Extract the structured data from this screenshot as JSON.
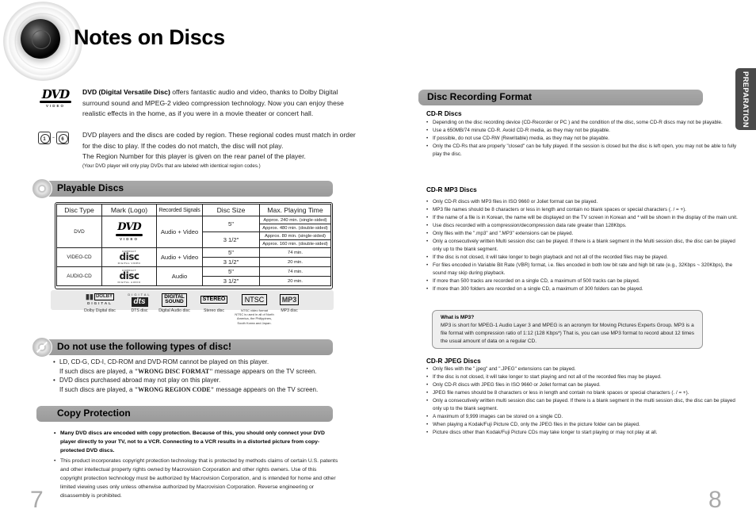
{
  "left_page": {
    "title": "Notes on Discs",
    "page_number": "7",
    "dvd_intro": {
      "logo_text": "DVD",
      "logo_sub": "VIDEO",
      "bold_lead": "DVD (Digital Versatile Disc)",
      "text": " offers fantastic audio and video, thanks to Dolby Digital surround sound and MPEG-2 video compression technology. Now you can enjoy these realistic effects in the home, as if you were in a movie theater or concert hall."
    },
    "region_intro": {
      "icon_from": "1",
      "icon_to": "6",
      "line1": "DVD players and the discs are coded by region. These regional codes must match in order for the disc to play. If the codes do not match, the disc will not play.",
      "line2": "The Region Number for this player is given on the rear panel of the player.",
      "note": "(Your DVD player will only play DVDs that are labeled with identical region codes.)"
    },
    "playable": {
      "heading": "Playable Discs",
      "headers": [
        "Disc Type",
        "Mark (Logo)",
        "Recorded Signals",
        "Disc Size",
        "Max. Playing Time"
      ],
      "rows": [
        {
          "type": "DVD",
          "logo": "DVD",
          "logo_sub": "VIDEO",
          "signals": "Audio + Video",
          "sizes": [
            {
              "size": "5\"",
              "times": [
                "Approx. 240 min. (single-sided)",
                "Approx. 480 min. (double-sided)"
              ]
            },
            {
              "size": "3 1/2\"",
              "times": [
                "Approx. 80 min. (single-sided)",
                "Approx. 160 min. (double-sided)"
              ]
            }
          ]
        },
        {
          "type": "VIDEO-CD",
          "logo": "disc",
          "logo_top": "COMPACT",
          "logo_sub": "DIGITAL VIDEO",
          "signals": "Audio + Video",
          "sizes": [
            {
              "size": "5\"",
              "times": [
                "74 min."
              ]
            },
            {
              "size": "3 1/2\"",
              "times": [
                "20 min."
              ]
            }
          ]
        },
        {
          "type": "AUDIO-CD",
          "logo": "disc",
          "logo_top": "COMPACT",
          "logo_sub": "DIGITAL AUDIO",
          "signals": "Audio",
          "sizes": [
            {
              "size": "5\"",
              "times": [
                "74 min."
              ]
            },
            {
              "size": "3 1/2\"",
              "times": [
                "20 min."
              ]
            }
          ]
        }
      ],
      "logos": [
        {
          "mark": "DOLBY",
          "mark_sub": "DIGITAL",
          "caption": "Dolby Digital disc"
        },
        {
          "mark": "dts",
          "mark_sub": "SURROUND",
          "mark_top": "DIGITAL",
          "caption": "DTS disc"
        },
        {
          "mark": "DIGITAL SOUND",
          "caption": "Digital Audio disc"
        },
        {
          "mark": "STEREO",
          "caption": "Stereo disc"
        },
        {
          "mark": "NTSC",
          "caption": "NTSC video format",
          "caption_extra": "NTSC is used in all of North America, the Philippines, South Korea and Japan."
        },
        {
          "mark": "MP3",
          "caption": "MP3 disc"
        }
      ]
    },
    "do_not_use": {
      "heading": "Do not use the following types of disc!",
      "items": [
        {
          "line1": "LD, CD-G, CD-I, CD-ROM and DVD-ROM cannot be played on this player.",
          "line2_pre": "If such discs are played, a ",
          "line2_msg": "\"WRONG DISC FORMAT\"",
          "line2_post": " message appears on the TV screen."
        },
        {
          "line1": "DVD discs purchased abroad may not play on this player.",
          "line2_pre": "If such discs are played, a ",
          "line2_msg": "\"WRONG REGION CODE\"",
          "line2_post": " message appears on the TV screen."
        }
      ]
    },
    "copy_protection": {
      "heading": "Copy Protection",
      "items": [
        "Many DVD discs are encoded with copy protection. Because of this, you should only connect your DVD player directly to your TV, not to a VCR. Connecting to a VCR results in a distorted picture from copy-protected DVD discs.",
        "This product incorporates copyright protection technology that is protected by methods claims of certain U.S. patents and other intellectual property rights owned by Macrovision Corporation and other rights owners. Use of this copyright protection technology must be authorized by Macrovision Corporation, and is intended for home and other limited viewing uses only unless otherwise authorized by Macrovision Corporation. Reverse engineering or disassembly is prohibited."
      ]
    }
  },
  "right_page": {
    "page_number": "8",
    "side_tab": "PREPARATION",
    "heading": "Disc Recording Format",
    "cdr": {
      "heading": "CD-R Discs",
      "items": [
        "Depending on the disc recording device (CD-Recorder or PC ) and the condition of the disc, some CD-R discs may not be playable.",
        "Use a 650MB/74 minute CD-R. Avoid CD-R media, as they may not be playable.",
        "If possible, do not use CD-RW (Rewritable) media, as they may not be playable.",
        "Only the CD-Rs that are properly \"closed\" can be fully played. If the session is closed but the disc is left open, you may not be able to fully play the disc."
      ]
    },
    "mp3": {
      "heading": "CD-R MP3 Discs",
      "items": [
        "Only CD-R discs with MP3 files in ISO 9660 or Joliet format can be played.",
        "MP3 file names should be 8 characters or less in length and contain no blank spaces or special characters (. / = +).",
        "If the name of a file is in Korean, the name will be displayed on the TV screen in Korean and * will be shown in the display of the main unit.",
        "Use discs recorded with a compression/decompression data rate greater than 128Kbps.",
        "Only files with the \".mp3\" and \".MP3\" extensions can be played.",
        "Only a consecutively written Multi session disc can be played. If there is a blank segment in the Multi session disc, the disc can be played only up to the blank segment.",
        "If the disc is not closed, it will take longer to begin playback and not all of the recorded files may be played.",
        "For files encoded in Variable Bit Rate (VBR) format, i.e. files encoded in both low bit rate and high bit rate (e.g., 32Kbps ~ 320Kbps), the sound may skip during playback.",
        "If more than 500 tracks are recorded on a single CD, a maximum of 500 tracks can be played.",
        "If more than 300 folders are recorded on a single CD, a maximum of 300 folders can be played."
      ]
    },
    "what_is_mp3": {
      "heading": "What is MP3?",
      "text": "MP3 is short for MPEG-1 Audio Layer 3 and MPEG is an acronym for Moving Pictures Experts Group. MP3 is a file format with compression ratio of 1:12 (128 Kbps*) That is, you can use MP3 format to record about 12 times the usual amount of data on a regular CD."
    },
    "jpeg": {
      "heading": "CD-R JPEG Discs",
      "items": [
        "Only files with the \".jpeg\" and \".JPEG\" extensions can be played.",
        "If the disc is not closed, it will take longer to start playing and not all of the recorded files may be played.",
        "Only CD-R discs with JPEG files in ISO 9660 or Joliet format can be played.",
        "JPEG file names should be 8 characters or less in length and contain no blank spaces or special characters (. / = +).",
        "Only a consecutively written multi session disc can be played. If there is a blank segment in the multi session disc, the disc can be played only up to the blank segment.",
        "A maximum of 9,999 images can be stored on a single CD.",
        "When playing a Kodak/Fuji Picture CD, only the JPEG files in the picture folder can be played.",
        "Picture discs other than Kodak/Fuji Picture CDs may take longer to start playing or may not play at all."
      ]
    }
  }
}
